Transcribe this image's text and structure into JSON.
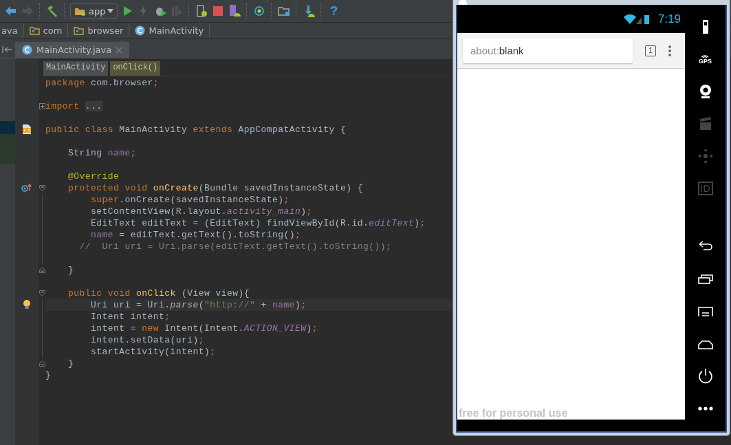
{
  "toolbar": {
    "items": [
      {
        "kind": "back",
        "disabled": false
      },
      {
        "kind": "forward",
        "disabled": true
      },
      {
        "kind": "make",
        "disabled": false
      },
      {
        "kind": "config",
        "label": "app",
        "disabled": false
      },
      {
        "kind": "run",
        "disabled": false
      },
      {
        "kind": "apply",
        "disabled": true
      },
      {
        "kind": "debug",
        "disabled": false
      },
      {
        "kind": "attach",
        "disabled": true
      },
      {
        "kind": "device",
        "disabled": false
      },
      {
        "kind": "stop",
        "disabled": false
      },
      {
        "kind": "avd",
        "disabled": false
      },
      {
        "kind": "sync",
        "disabled": false
      },
      {
        "kind": "structure",
        "disabled": false
      },
      {
        "kind": "sdk",
        "disabled": false
      },
      {
        "kind": "help",
        "label": "?",
        "disabled": false
      }
    ]
  },
  "navigation": [
    {
      "kind": "text",
      "label": "ava"
    },
    {
      "kind": "package",
      "label": "com"
    },
    {
      "kind": "package",
      "label": "browser"
    },
    {
      "kind": "class",
      "label": "MainActivity"
    }
  ],
  "tabs": [
    {
      "label": "MainActivity.java",
      "selected": true
    }
  ],
  "structure": [
    {
      "label": "MainActivity",
      "selected": false
    },
    {
      "label": "onClick()",
      "selected": true
    }
  ],
  "code": [
    {
      "kind": "code",
      "tokens": [
        {
          "kind": "kw",
          "text": "package"
        },
        {
          "kind": "plain",
          "text": " com.browser"
        },
        {
          "kind": "kw",
          "text": ";"
        }
      ]
    },
    {
      "kind": "blank"
    },
    {
      "kind": "code",
      "fold": {
        "kind": "plus"
      },
      "tokens": [
        {
          "kind": "kw",
          "text": "import "
        },
        {
          "kind": "folded",
          "text": "..."
        }
      ]
    },
    {
      "kind": "blank"
    },
    {
      "kind": "code",
      "marker": {
        "kind": "class"
      },
      "tokens": [
        {
          "kind": "kw",
          "text": "public class"
        },
        {
          "kind": "plain",
          "text": " MainActivity "
        },
        {
          "kind": "kw",
          "text": "extends"
        },
        {
          "kind": "plain",
          "text": " AppCompatActivity {"
        }
      ]
    },
    {
      "kind": "blank"
    },
    {
      "kind": "code",
      "tokens": [
        {
          "kind": "plain",
          "text": "    String "
        },
        {
          "kind": "field",
          "text": "name"
        },
        {
          "kind": "kw",
          "text": ";"
        }
      ]
    },
    {
      "kind": "blank"
    },
    {
      "kind": "code",
      "tokens": [
        {
          "kind": "annot",
          "text": "    @Override"
        }
      ]
    },
    {
      "kind": "code",
      "marker": {
        "kind": "override"
      },
      "fold": {
        "kind": "start"
      },
      "tokens": [
        {
          "kind": "kw",
          "text": "    protected void"
        },
        {
          "kind": "method",
          "text": " onCreate"
        },
        {
          "kind": "plain",
          "text": "(Bundle savedInstanceState) {"
        }
      ]
    },
    {
      "kind": "code",
      "fold": {
        "kind": "guide"
      },
      "tokens": [
        {
          "kind": "kw",
          "text": "        super"
        },
        {
          "kind": "plain",
          "text": ".onCreate(savedInstanceState)"
        },
        {
          "kind": "kw",
          "text": ";"
        }
      ]
    },
    {
      "kind": "code",
      "fold": {
        "kind": "guide"
      },
      "tokens": [
        {
          "kind": "plain",
          "text": "        setContentView(R.layout."
        },
        {
          "kind": "static",
          "text": "activity_main"
        },
        {
          "kind": "plain",
          "text": ")"
        },
        {
          "kind": "kw",
          "text": ";"
        }
      ]
    },
    {
      "kind": "code",
      "fold": {
        "kind": "guide"
      },
      "tokens": [
        {
          "kind": "plain",
          "text": "        EditText editText = (EditText) findViewById(R.id."
        },
        {
          "kind": "static",
          "text": "editText"
        },
        {
          "kind": "plain",
          "text": ")"
        },
        {
          "kind": "kw",
          "text": ";"
        }
      ]
    },
    {
      "kind": "code",
      "fold": {
        "kind": "guide"
      },
      "tokens": [
        {
          "kind": "field",
          "text": "        name"
        },
        {
          "kind": "plain",
          "text": " = editText.getText().toString()"
        },
        {
          "kind": "kw",
          "text": ";"
        }
      ]
    },
    {
      "kind": "code",
      "fold": {
        "kind": "guide"
      },
      "tokens": [
        {
          "kind": "comment",
          "text": "      //  Uri uri = Uri.parse(editText.getText().toString());"
        }
      ]
    },
    {
      "kind": "blank",
      "fold": {
        "kind": "guide"
      }
    },
    {
      "kind": "code",
      "fold": {
        "kind": "end"
      },
      "tokens": [
        {
          "kind": "plain",
          "text": "    }"
        }
      ]
    },
    {
      "kind": "blank"
    },
    {
      "kind": "code",
      "fold": {
        "kind": "start"
      },
      "tokens": [
        {
          "kind": "kw",
          "text": "    public void"
        },
        {
          "kind": "method",
          "text": " onClick"
        },
        {
          "kind": "plain",
          "text": " (View view){"
        }
      ]
    },
    {
      "kind": "code",
      "marker": {
        "kind": "intention"
      },
      "fold": {
        "kind": "guide"
      },
      "current": true,
      "tokens": [
        {
          "kind": "plain",
          "text": "        Uri uri = Uri."
        },
        {
          "kind": "call",
          "text": "parse"
        },
        {
          "kind": "plain",
          "text": "("
        },
        {
          "kind": "string",
          "text": "\"http://\""
        },
        {
          "kind": "plain",
          "text": " + "
        },
        {
          "kind": "field",
          "text": "name"
        },
        {
          "kind": "plain",
          "text": ")"
        },
        {
          "kind": "kw",
          "text": ";"
        }
      ]
    },
    {
      "kind": "code",
      "fold": {
        "kind": "guide"
      },
      "tokens": [
        {
          "kind": "plain",
          "text": "        Intent intent"
        },
        {
          "kind": "kw",
          "text": ";"
        }
      ]
    },
    {
      "kind": "code",
      "fold": {
        "kind": "guide"
      },
      "tokens": [
        {
          "kind": "plain",
          "text": "        intent = "
        },
        {
          "kind": "kw",
          "text": "new"
        },
        {
          "kind": "plain",
          "text": " Intent(Intent."
        },
        {
          "kind": "static",
          "text": "ACTION_VIEW"
        },
        {
          "kind": "plain",
          "text": ")"
        },
        {
          "kind": "kw",
          "text": ";"
        }
      ]
    },
    {
      "kind": "code",
      "fold": {
        "kind": "guide"
      },
      "tokens": [
        {
          "kind": "plain",
          "text": "        intent.setData(uri)"
        },
        {
          "kind": "kw",
          "text": ";"
        }
      ]
    },
    {
      "kind": "code",
      "fold": {
        "kind": "guide"
      },
      "tokens": [
        {
          "kind": "plain",
          "text": "        startActivity(intent)"
        },
        {
          "kind": "kw",
          "text": ";"
        }
      ]
    },
    {
      "kind": "code",
      "fold": {
        "kind": "end"
      },
      "tokens": [
        {
          "kind": "plain",
          "text": "    }"
        }
      ]
    },
    {
      "kind": "code",
      "tokens": [
        {
          "kind": "plain",
          "text": "}"
        }
      ]
    }
  ],
  "emulator": {
    "time": "7:19",
    "url_scheme": "about:",
    "url_rest": "blank",
    "tab_count": "1",
    "watermark": "free for personal use",
    "side_buttons": [
      {
        "kind": "battery",
        "disabled": false
      },
      {
        "kind": "gps",
        "label": "GPS",
        "disabled": false
      },
      {
        "kind": "camera",
        "disabled": false
      },
      {
        "kind": "clapper",
        "disabled": true
      },
      {
        "kind": "dpad",
        "disabled": true
      },
      {
        "kind": "id",
        "label": "ID",
        "disabled": true
      },
      {
        "kind": "back",
        "disabled": false
      },
      {
        "kind": "recent",
        "disabled": false
      },
      {
        "kind": "menu",
        "disabled": false
      },
      {
        "kind": "home",
        "disabled": false
      },
      {
        "kind": "power",
        "disabled": false
      },
      {
        "kind": "more",
        "disabled": false
      }
    ]
  }
}
